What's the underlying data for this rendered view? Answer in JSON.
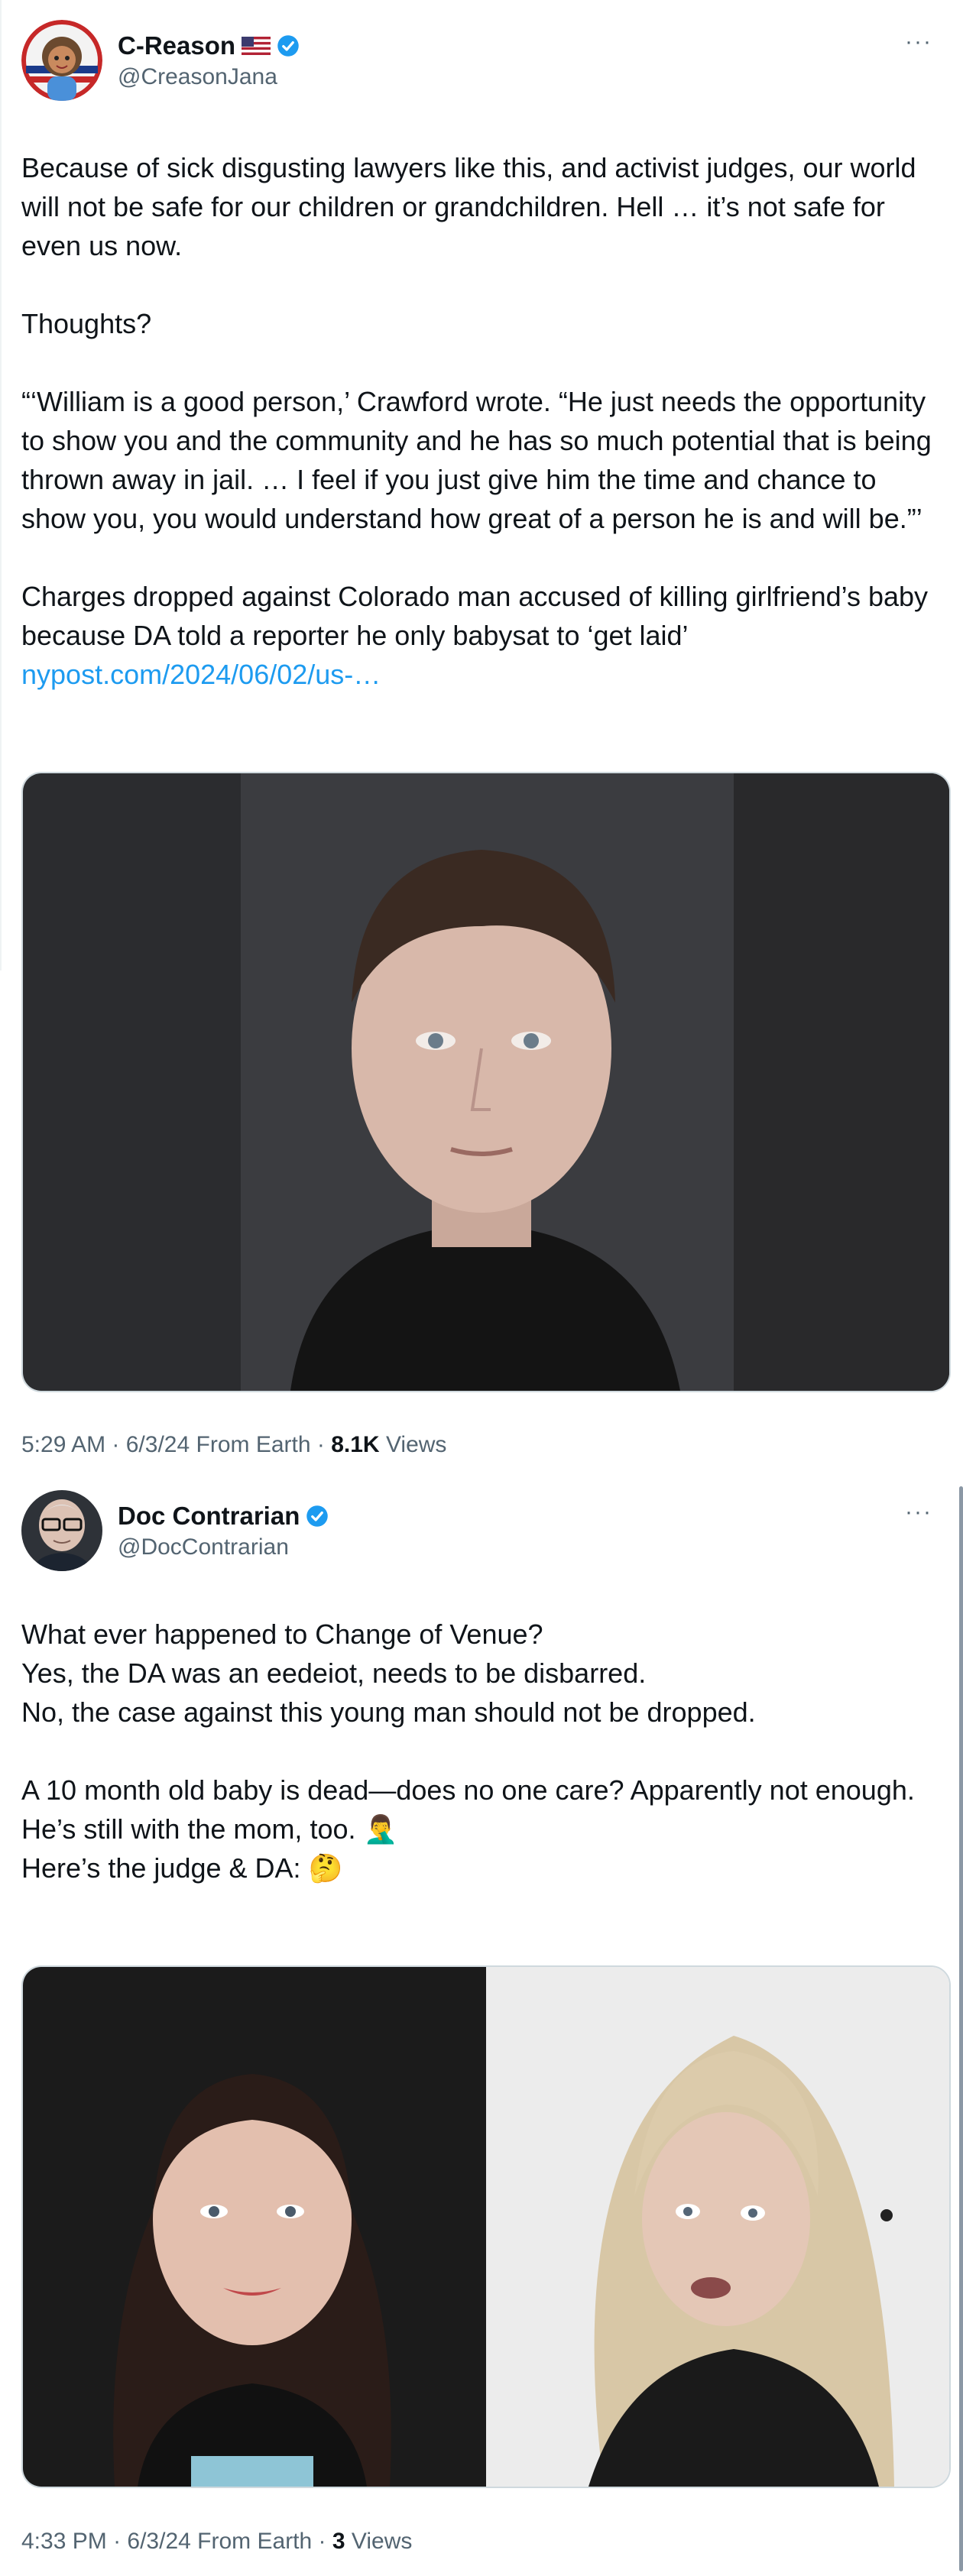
{
  "tweets": [
    {
      "display_name": "C-Reason",
      "handle": "@CreasonJana",
      "more_label": "···",
      "body": [
        "Because of sick disgusting lawyers like this, and activist judges, our world will not be safe for our children or grandchildren. Hell … it’s not safe for even us now.",
        "Thoughts?",
        "“‘William is a good person,’ Crawford wrote. “He just needs the opportunity to show you and the community and he has so much potential that is being thrown away in jail. … I feel if you just give him the time and chance to show you, you would understand how great of a person he is and will be.”’",
        "Charges dropped against Colorado man accused of killing girlfriend’s baby because DA told a reporter he only babysat to ‘get laid’"
      ],
      "link": "nypost.com/2024/06/02/us-…",
      "time": "5:29 AM",
      "date": "6/3/24",
      "source": "From Earth",
      "views_count": "8.1K",
      "views_label": "Views"
    },
    {
      "display_name": "Doc Contrarian",
      "handle": "@DocContrarian",
      "more_label": "···",
      "body": [
        "What ever happened to Change of Venue?",
        "Yes, the DA was an eedeiot, needs to be disbarred.",
        "No, the case against this young man should not be dropped.",
        "A 10 month old baby is dead—does no one care? Apparently not enough.",
        "He’s still with the mom, too. 🤦‍♂️",
        "Here’s the judge & DA: 🤔"
      ],
      "time": "4:33 PM",
      "date": "6/3/24",
      "source": "From Earth",
      "views_count": "3",
      "views_label": "Views"
    }
  ],
  "colors": {
    "link": "#1d9bf0",
    "verified": "#1d9bf0",
    "secondary_text": "#536471"
  },
  "icons": [
    "verified-badge-icon",
    "us-flag-icon",
    "more-icon"
  ]
}
